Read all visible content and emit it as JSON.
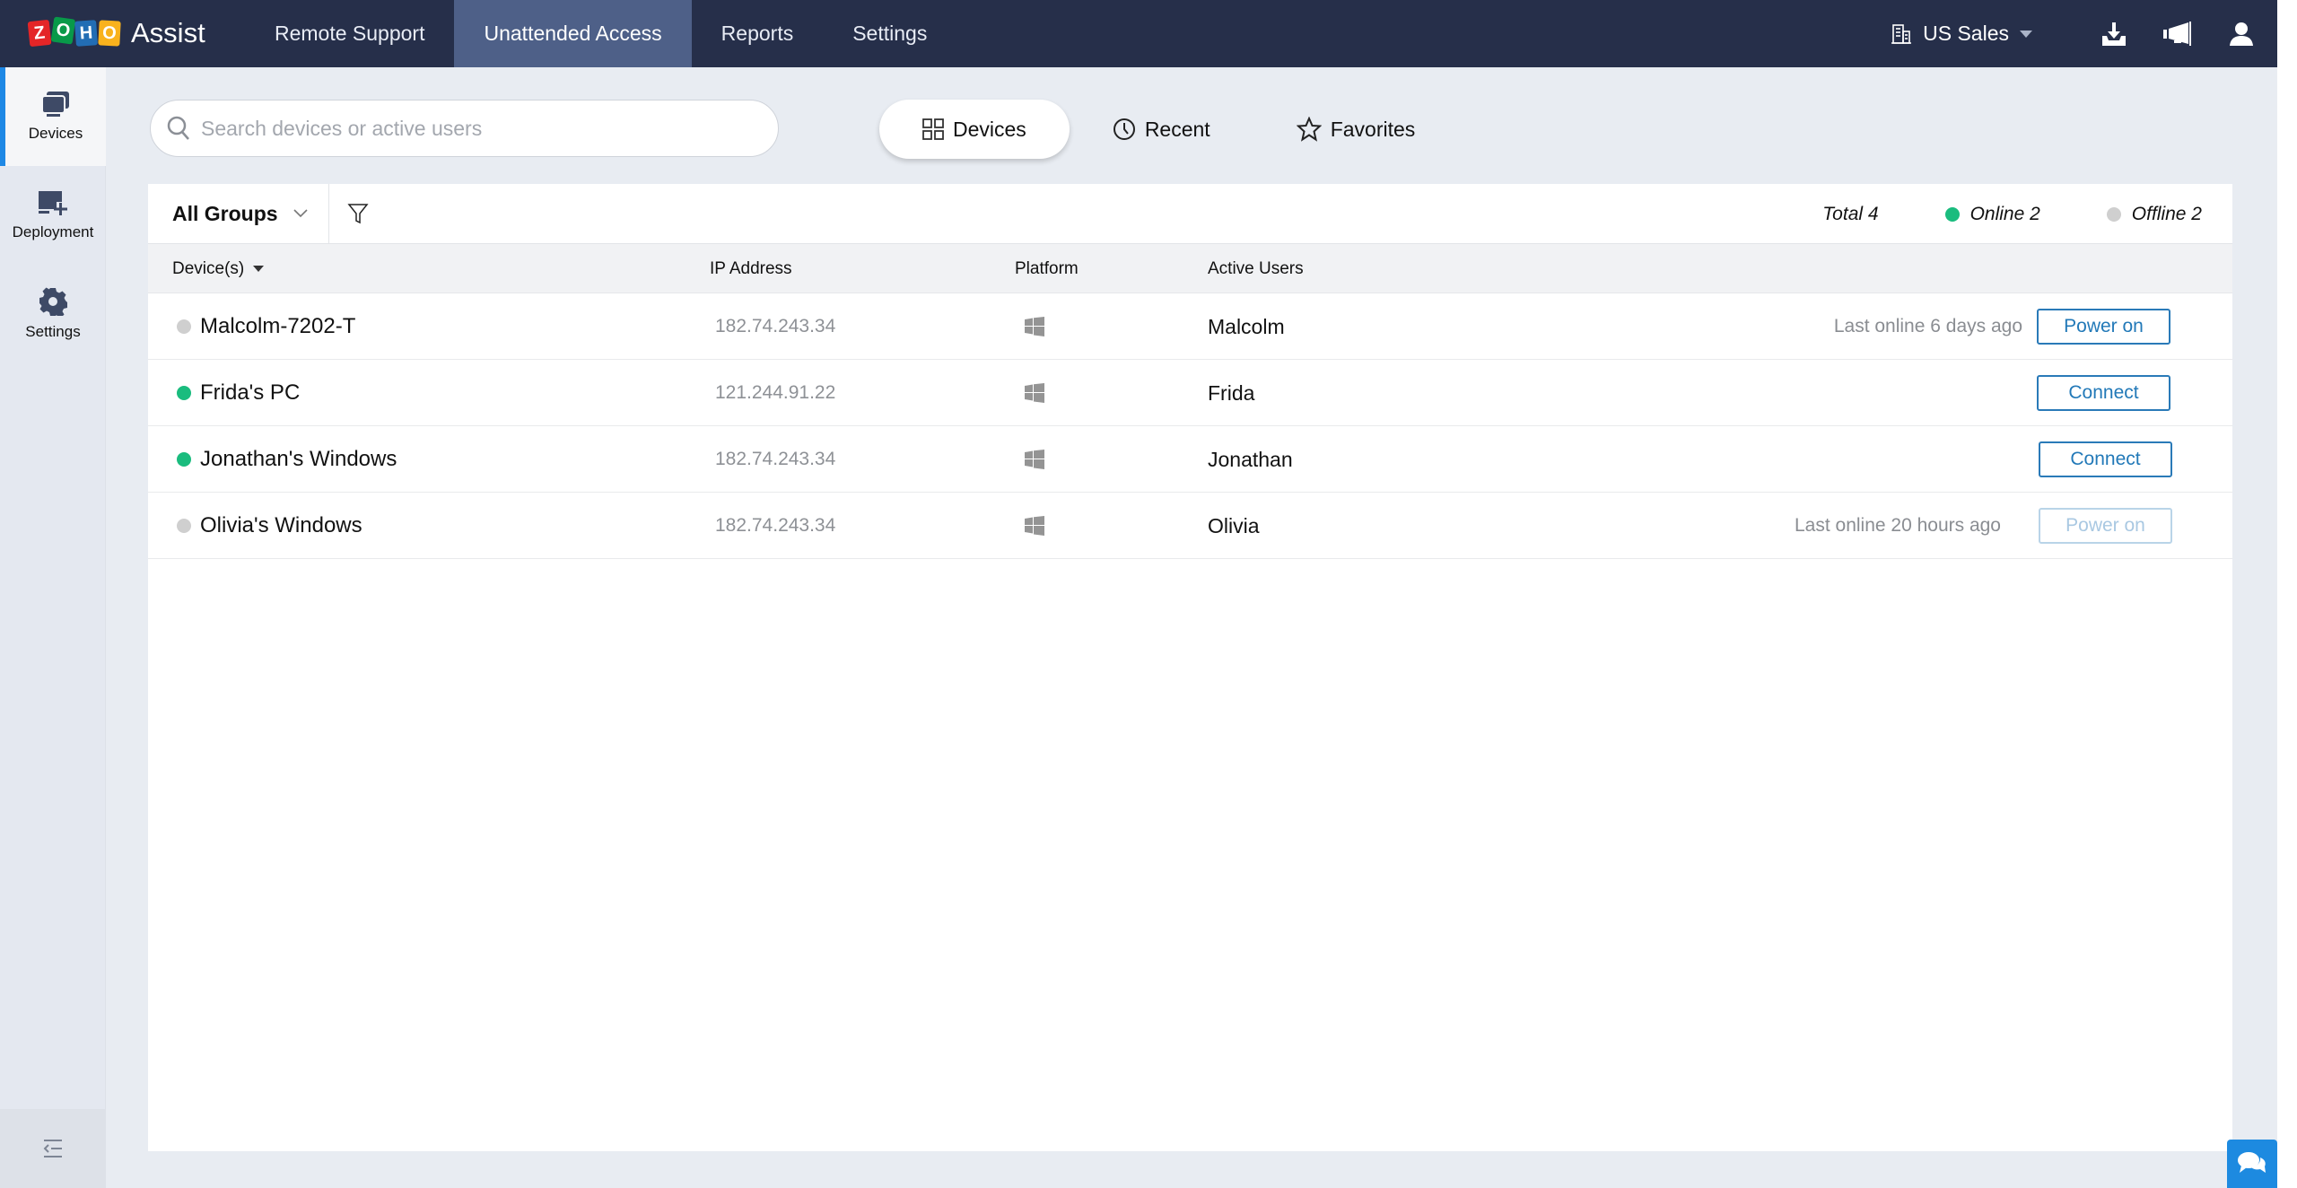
{
  "header": {
    "logo_letters": [
      "Z",
      "O",
      "H",
      "O"
    ],
    "app_name": "Assist",
    "nav": [
      {
        "label": "Remote Support",
        "active": false
      },
      {
        "label": "Unattended Access",
        "active": true
      },
      {
        "label": "Reports",
        "active": false
      },
      {
        "label": "Settings",
        "active": false
      }
    ],
    "org_name": "US Sales",
    "icons": [
      "building-icon",
      "download-icon",
      "megaphone-icon",
      "user-icon"
    ]
  },
  "sidebar": {
    "items": [
      {
        "label": "Devices",
        "icon": "devices-icon",
        "active": true
      },
      {
        "label": "Deployment",
        "icon": "deployment-icon",
        "active": false
      },
      {
        "label": "Settings",
        "icon": "gear-icon",
        "active": false
      }
    ],
    "collapse_icon": "collapse-sidebar-icon"
  },
  "search": {
    "placeholder": "Search devices or active users",
    "value": ""
  },
  "view_tabs": [
    {
      "label": "Devices",
      "icon": "grid-icon",
      "active": true
    },
    {
      "label": "Recent",
      "icon": "clock-icon",
      "active": false
    },
    {
      "label": "Favorites",
      "icon": "star-icon",
      "active": false
    }
  ],
  "toolbar": {
    "group_selected": "All Groups",
    "stats": {
      "total": "Total 4",
      "online": "Online 2",
      "offline": "Offline 2"
    }
  },
  "colors": {
    "online": "#1abc7e",
    "offline": "#cfcfcf",
    "accent": "#2279b8",
    "header_bg": "#262f4a"
  },
  "table": {
    "columns": [
      "Device(s)",
      "IP Address",
      "Platform",
      "Active Users"
    ],
    "rows": [
      {
        "name": "Malcolm-7202-T",
        "status": "offline",
        "ip": "182.74.243.34",
        "platform": "windows",
        "user": "Malcolm",
        "last_online": "Last online 6 days ago",
        "action": "Power on",
        "action_disabled": false
      },
      {
        "name": "Frida's PC",
        "status": "online",
        "ip": "121.244.91.22",
        "platform": "windows",
        "user": "Frida",
        "last_online": "",
        "action": "Connect",
        "action_disabled": false
      },
      {
        "name": "Jonathan's Windows",
        "status": "online",
        "ip": "182.74.243.34",
        "platform": "windows",
        "user": "Jonathan",
        "last_online": "",
        "action": "Connect",
        "action_disabled": false
      },
      {
        "name": "Olivia's Windows",
        "status": "offline",
        "ip": "182.74.243.34",
        "platform": "windows",
        "user": "Olivia",
        "last_online": "Last online 20 hours ago",
        "action": "Power on",
        "action_disabled": true
      }
    ]
  }
}
